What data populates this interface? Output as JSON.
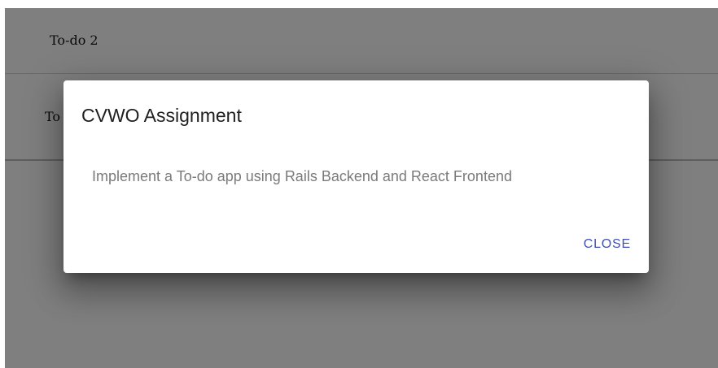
{
  "todos": [
    {
      "title": "To-do 2"
    },
    {
      "title": "To"
    }
  ],
  "dialog": {
    "title": "CVWO Assignment",
    "content": "Implement a To-do app using Rails Backend and React Frontend",
    "close_label": "CLOSE"
  },
  "colors": {
    "backdrop": "#7f7f7f",
    "accent": "#3f51b5",
    "dialog_background": "#ffffff"
  }
}
